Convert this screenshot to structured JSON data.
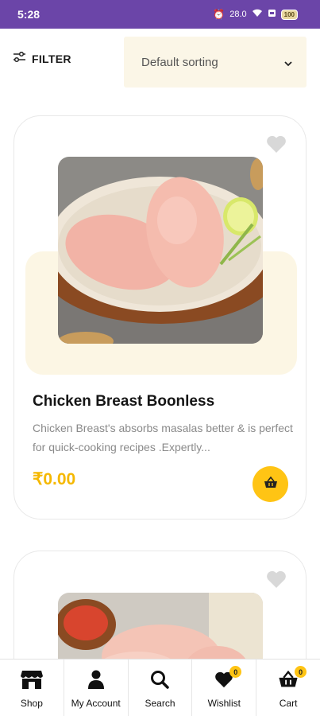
{
  "status_bar": {
    "time": "5:28",
    "network": "28.0",
    "battery": "100",
    "bg_color": "#6b45a8"
  },
  "toolbar": {
    "filter_label": "FILTER",
    "filter_icon": "sliders-icon",
    "sort_value": "Default sorting",
    "sort_icon": "chevron-down-icon"
  },
  "products": [
    {
      "title": "Chicken Breast Boonless",
      "description": "Chicken Breast's absorbs masalas better & is perfect for quick-cooking recipes .Expertly...",
      "price": "₹0.00",
      "wishlist_icon": "heart-icon",
      "cart_icon": "basket-icon"
    },
    {
      "wishlist_icon": "heart-icon"
    }
  ],
  "bottom_nav": [
    {
      "label": "Shop",
      "icon": "store-icon"
    },
    {
      "label": "My Account",
      "icon": "user-icon"
    },
    {
      "label": "Search",
      "icon": "search-icon"
    },
    {
      "label": "Wishlist",
      "icon": "heart-icon",
      "badge": "0"
    },
    {
      "label": "Cart",
      "icon": "basket-icon",
      "badge": "0"
    }
  ],
  "colors": {
    "accent": "#ffc414",
    "price": "#f5b800",
    "sort_bg": "#fbf6e7"
  }
}
